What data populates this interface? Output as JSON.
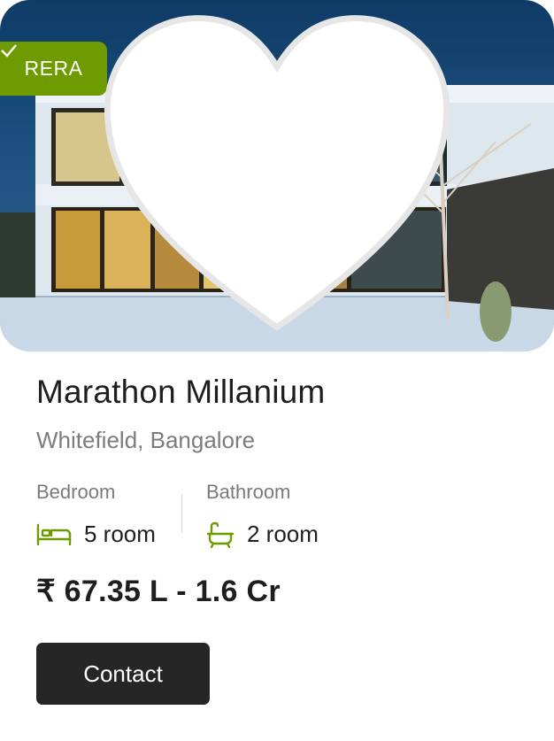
{
  "badge": {
    "label": "RERA",
    "color": "#6e9b00"
  },
  "favorite": {
    "icon": "heart-icon"
  },
  "property": {
    "name": "Marathon Millanium",
    "location": "Whitefield, Bangalore"
  },
  "specs": {
    "bedroom": {
      "label": "Bedroom",
      "value": "5 room",
      "icon": "bed-icon"
    },
    "bathroom": {
      "label": "Bathroom",
      "value": "2 room",
      "icon": "bathtub-icon"
    }
  },
  "price": "₹ 67.35 L - 1.6 Cr",
  "cta": {
    "label": "Contact"
  },
  "colors": {
    "accent": "#6e9b00",
    "button": "#262626"
  }
}
